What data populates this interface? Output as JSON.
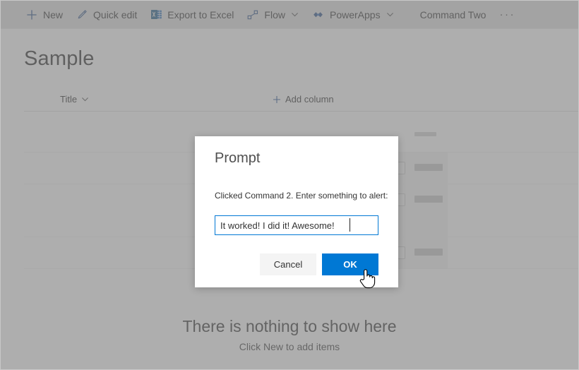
{
  "commandbar": {
    "items": [
      {
        "label": "New",
        "icon": "plus-icon",
        "chevron": false
      },
      {
        "label": "Quick edit",
        "icon": "pencil-icon",
        "chevron": false
      },
      {
        "label": "Export to Excel",
        "icon": "excel-icon",
        "chevron": false
      },
      {
        "label": "Flow",
        "icon": "flow-icon",
        "chevron": true
      },
      {
        "label": "PowerApps",
        "icon": "powerapps-icon",
        "chevron": true
      },
      {
        "label": "Command Two",
        "icon": "none",
        "chevron": false
      }
    ],
    "overflow_label": "···",
    "overflow_name": "ellipsis-icon"
  },
  "page": {
    "title": "Sample"
  },
  "list": {
    "columns": [
      {
        "label": "Title",
        "sortable": true
      }
    ],
    "add_column_label": "Add column",
    "add_column_icon": "plus-icon",
    "empty_title": "There is nothing to show here",
    "empty_subtitle": "Click New to add items"
  },
  "dialog": {
    "title": "Prompt",
    "message": "Clicked Command 2. Enter something to alert:",
    "input_value": "It worked! I did it! Awesome!",
    "input_placeholder": "",
    "cancel_label": "Cancel",
    "ok_label": "OK"
  },
  "colors": {
    "accent": "#0078d4",
    "command_text": "#333333",
    "overlay": "rgba(125,125,125,0.62)",
    "dialog_background": "#ffffff",
    "primary_button": "#0078d4",
    "secondary_button": "#f4f4f4"
  },
  "cursor": {
    "type": "pointer-hand"
  }
}
